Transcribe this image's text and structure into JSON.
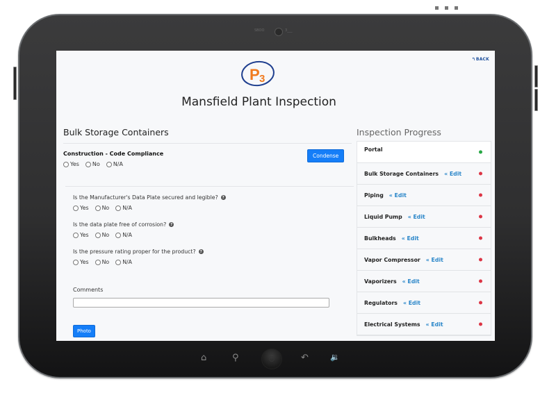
{
  "device": {
    "brand_left": "SBOO",
    "brand_right": "3___",
    "nav_icons": [
      "home-icon",
      "search-icon",
      "back-arrow-icon",
      "volume-icon"
    ]
  },
  "header": {
    "back_label": "BACK",
    "logo_text": "P3",
    "title": "Mansfield Plant Inspection"
  },
  "section": {
    "title": "Bulk Storage Containers",
    "group_title": "Construction - Code Compliance",
    "condense_label": "Condense",
    "group_options": [
      "Yes",
      "No",
      "N/A"
    ]
  },
  "questions": [
    {
      "text": "Is the Manufacturer's Data Plate secured and legible?",
      "options": [
        "Yes",
        "No",
        "N/A"
      ]
    },
    {
      "text": "Is the data plate free of corrosion?",
      "options": [
        "Yes",
        "No",
        "N/A"
      ]
    },
    {
      "text": "Is the pressure rating proper for the product?",
      "options": [
        "Yes",
        "No",
        "N/A"
      ]
    }
  ],
  "comments": {
    "label": "Comments",
    "value": ""
  },
  "photo_label": "Photo",
  "progress": {
    "title": "Inspection Progress",
    "edit_label": "« Edit",
    "colors": {
      "complete": "#28a745",
      "incomplete": "#dc3545"
    },
    "items": [
      {
        "label": "Portal",
        "status": "complete",
        "editable": false
      },
      {
        "label": "Bulk Storage Containers",
        "status": "incomplete",
        "editable": true
      },
      {
        "label": "Piping",
        "status": "incomplete",
        "editable": true
      },
      {
        "label": "Liquid Pump",
        "status": "incomplete",
        "editable": true
      },
      {
        "label": "Bulkheads",
        "status": "incomplete",
        "editable": true
      },
      {
        "label": "Vapor Compressor",
        "status": "incomplete",
        "editable": true
      },
      {
        "label": "Vaporizers",
        "status": "incomplete",
        "editable": true
      },
      {
        "label": "Regulators",
        "status": "incomplete",
        "editable": true
      },
      {
        "label": "Electrical Systems",
        "status": "incomplete",
        "editable": true
      }
    ]
  }
}
